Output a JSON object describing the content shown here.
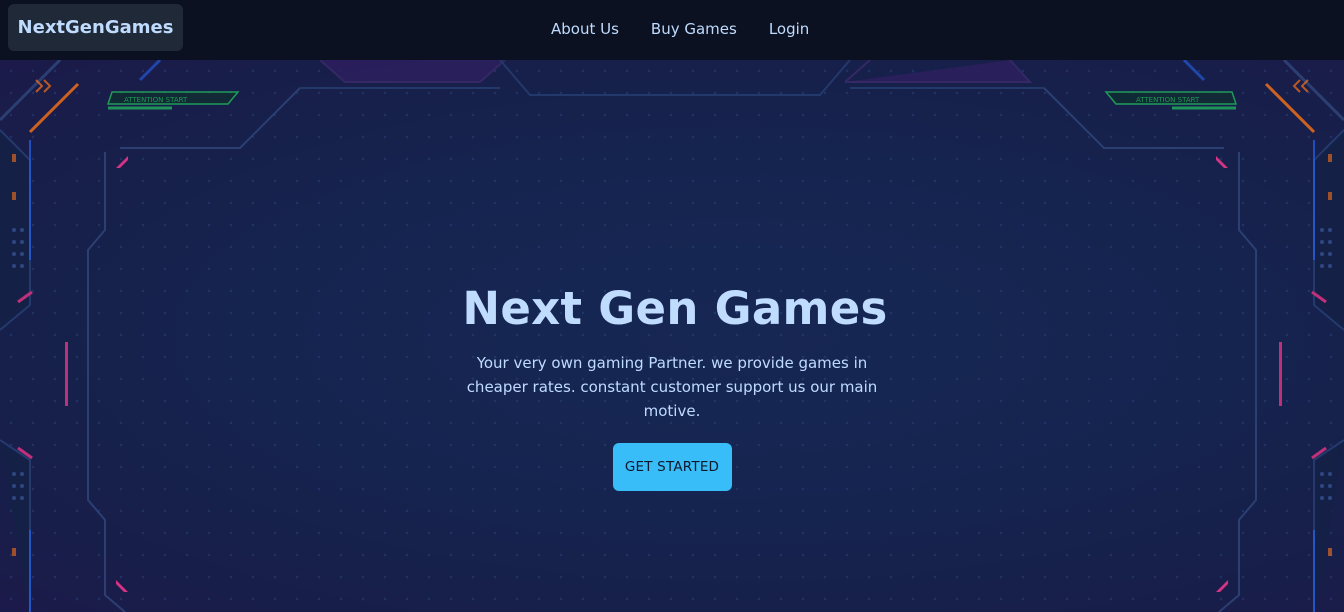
{
  "navbar": {
    "brand": "NextGenGames",
    "links": [
      {
        "label": "About Us"
      },
      {
        "label": "Buy Games"
      },
      {
        "label": "Login"
      }
    ]
  },
  "hero": {
    "title": "Next Gen Games",
    "description": "Your very own gaming Partner. we provide games in cheaper rates. constant customer support us our main motive.",
    "cta_label": "GET STARTED",
    "hud_labels": {
      "left": "ATTENTION   START",
      "right": "ATTENTION   START"
    }
  },
  "colors": {
    "navbar_bg": "#0b1120",
    "brand_bg": "#1f2937",
    "text": "#bfdbfe",
    "accent": "#38bdf8",
    "hud_pink": "#d63384",
    "hud_green": "#22c55e",
    "hud_orange": "#f97316"
  }
}
